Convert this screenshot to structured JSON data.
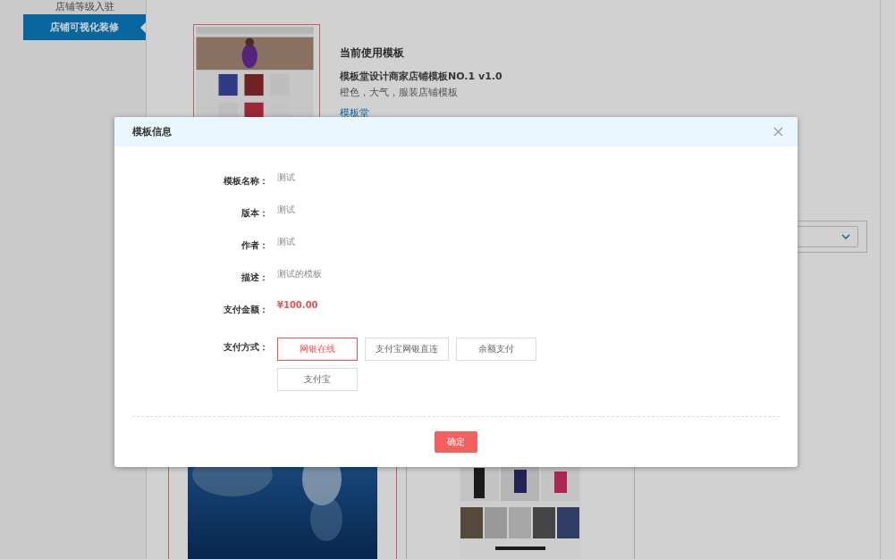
{
  "sidebar": {
    "items": [
      {
        "label": "店铺等级入驻",
        "selected": false
      },
      {
        "label": "店铺可视化装修",
        "selected": true
      }
    ]
  },
  "current_template": {
    "heading": "当前使用模板",
    "name": "模板堂设计商家店铺模板NO.1 v1.0",
    "description": "橙色，大气，服装店铺模板",
    "author": "模板堂"
  },
  "template_cards": [
    {
      "selected": true
    },
    {
      "selected": false
    }
  ],
  "dialog": {
    "title": "模板信息",
    "fields": [
      {
        "label": "模板名称：",
        "value": "测试",
        "kind": "text"
      },
      {
        "label": "版本：",
        "value": "测试",
        "kind": "text"
      },
      {
        "label": "作者：",
        "value": "测试",
        "kind": "text"
      },
      {
        "label": "描述：",
        "value": "测试的模板",
        "kind": "text"
      },
      {
        "label": "支付金额：",
        "value": "¥100.00",
        "kind": "price"
      }
    ],
    "payment": {
      "label": "支付方式：",
      "methods": [
        {
          "label": "网银在线",
          "selected": true
        },
        {
          "label": "支付宝网银直连",
          "selected": false
        },
        {
          "label": "余额支付",
          "selected": false
        },
        {
          "label": "支付宝",
          "selected": false
        }
      ]
    },
    "confirm": "确定"
  }
}
